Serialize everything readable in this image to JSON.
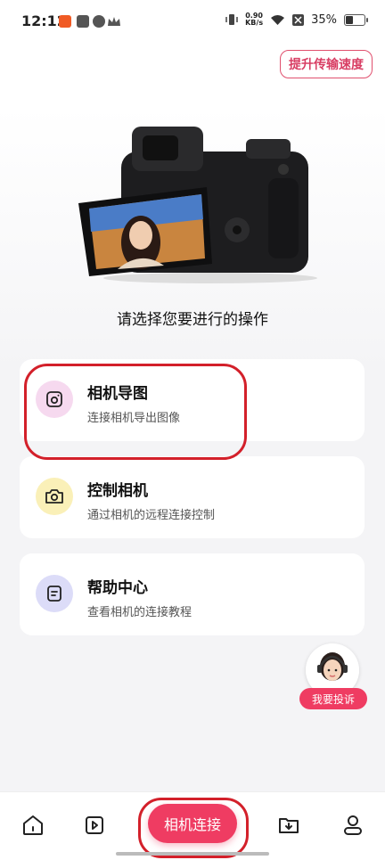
{
  "status_bar": {
    "time": "12:12",
    "net_speed_value": "0.90",
    "net_speed_unit": "KB/s",
    "battery": "35%"
  },
  "top_button": {
    "label": "提升传输速度"
  },
  "prompt": "请选择您要进行的操作",
  "options": [
    {
      "title": "相机导图",
      "subtitle": "连接相机导出图像",
      "icon": "camera-square-icon",
      "icon_bg": "#f6d9ef"
    },
    {
      "title": "控制相机",
      "subtitle": "通过相机的远程连接控制",
      "icon": "camera-icon",
      "icon_bg": "#faf0b8"
    },
    {
      "title": "帮助中心",
      "subtitle": "查看相机的连接教程",
      "icon": "document-icon",
      "icon_bg": "#dcdcf8"
    }
  ],
  "complaint": {
    "label": "我要投诉"
  },
  "tabbar": {
    "connect_label": "相机连接"
  },
  "colors": {
    "accent": "#ef3c62",
    "annotation": "#d3202a"
  }
}
